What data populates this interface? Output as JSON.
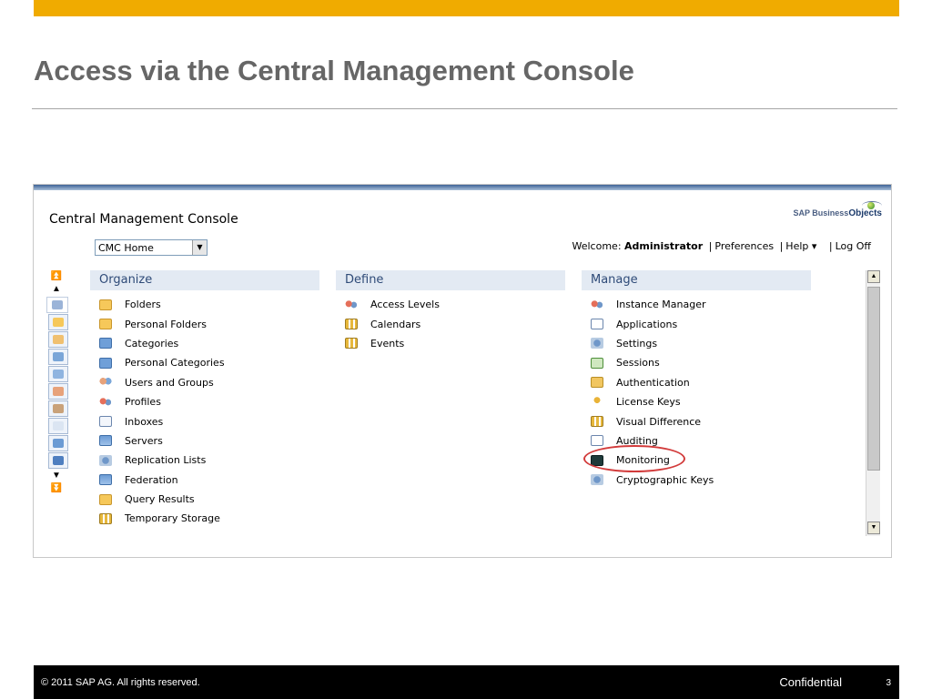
{
  "slide": {
    "title": "Access via the Central Management Console",
    "footer_copyright": "© 2011 SAP AG. All rights reserved.",
    "footer_label": "Confidential",
    "page_number": "3",
    "accent_color": "#f0ab00"
  },
  "cmc": {
    "title": "Central Management Console",
    "logo_text_a": "SAP Business",
    "logo_text_b": "Objects",
    "home_select": "CMC Home",
    "welcome_label": "Welcome:",
    "user": "Administrator",
    "preferences": "Preferences",
    "help": "Help ▾",
    "logoff": "Log Off",
    "columns": {
      "organize": {
        "title": "Organize",
        "items": [
          {
            "label": "Folders",
            "icon": "folder-icon"
          },
          {
            "label": "Personal Folders",
            "icon": "personal-folder-icon"
          },
          {
            "label": "Categories",
            "icon": "categories-icon"
          },
          {
            "label": "Personal Categories",
            "icon": "personal-categories-icon"
          },
          {
            "label": "Users and Groups",
            "icon": "users-icon"
          },
          {
            "label": "Profiles",
            "icon": "profiles-icon"
          },
          {
            "label": "Inboxes",
            "icon": "inbox-icon"
          },
          {
            "label": "Servers",
            "icon": "server-icon"
          },
          {
            "label": "Replication Lists",
            "icon": "replication-icon"
          },
          {
            "label": "Federation",
            "icon": "federation-icon"
          },
          {
            "label": "Query Results",
            "icon": "query-results-icon"
          },
          {
            "label": "Temporary Storage",
            "icon": "temporary-storage-icon"
          }
        ]
      },
      "define": {
        "title": "Define",
        "items": [
          {
            "label": "Access Levels",
            "icon": "access-levels-icon"
          },
          {
            "label": "Calendars",
            "icon": "calendar-icon"
          },
          {
            "label": "Events",
            "icon": "events-icon"
          }
        ]
      },
      "manage": {
        "title": "Manage",
        "items": [
          {
            "label": "Instance Manager",
            "icon": "instance-manager-icon"
          },
          {
            "label": "Applications",
            "icon": "applications-icon"
          },
          {
            "label": "Settings",
            "icon": "settings-icon"
          },
          {
            "label": "Sessions",
            "icon": "sessions-icon"
          },
          {
            "label": "Authentication",
            "icon": "authentication-icon"
          },
          {
            "label": "License Keys",
            "icon": "key-icon"
          },
          {
            "label": "Visual Difference",
            "icon": "visual-difference-icon"
          },
          {
            "label": "Auditing",
            "icon": "auditing-icon"
          },
          {
            "label": "Monitoring",
            "icon": "monitoring-icon"
          },
          {
            "label": "Cryptographic Keys",
            "icon": "cryptographic-keys-icon"
          }
        ]
      }
    }
  }
}
